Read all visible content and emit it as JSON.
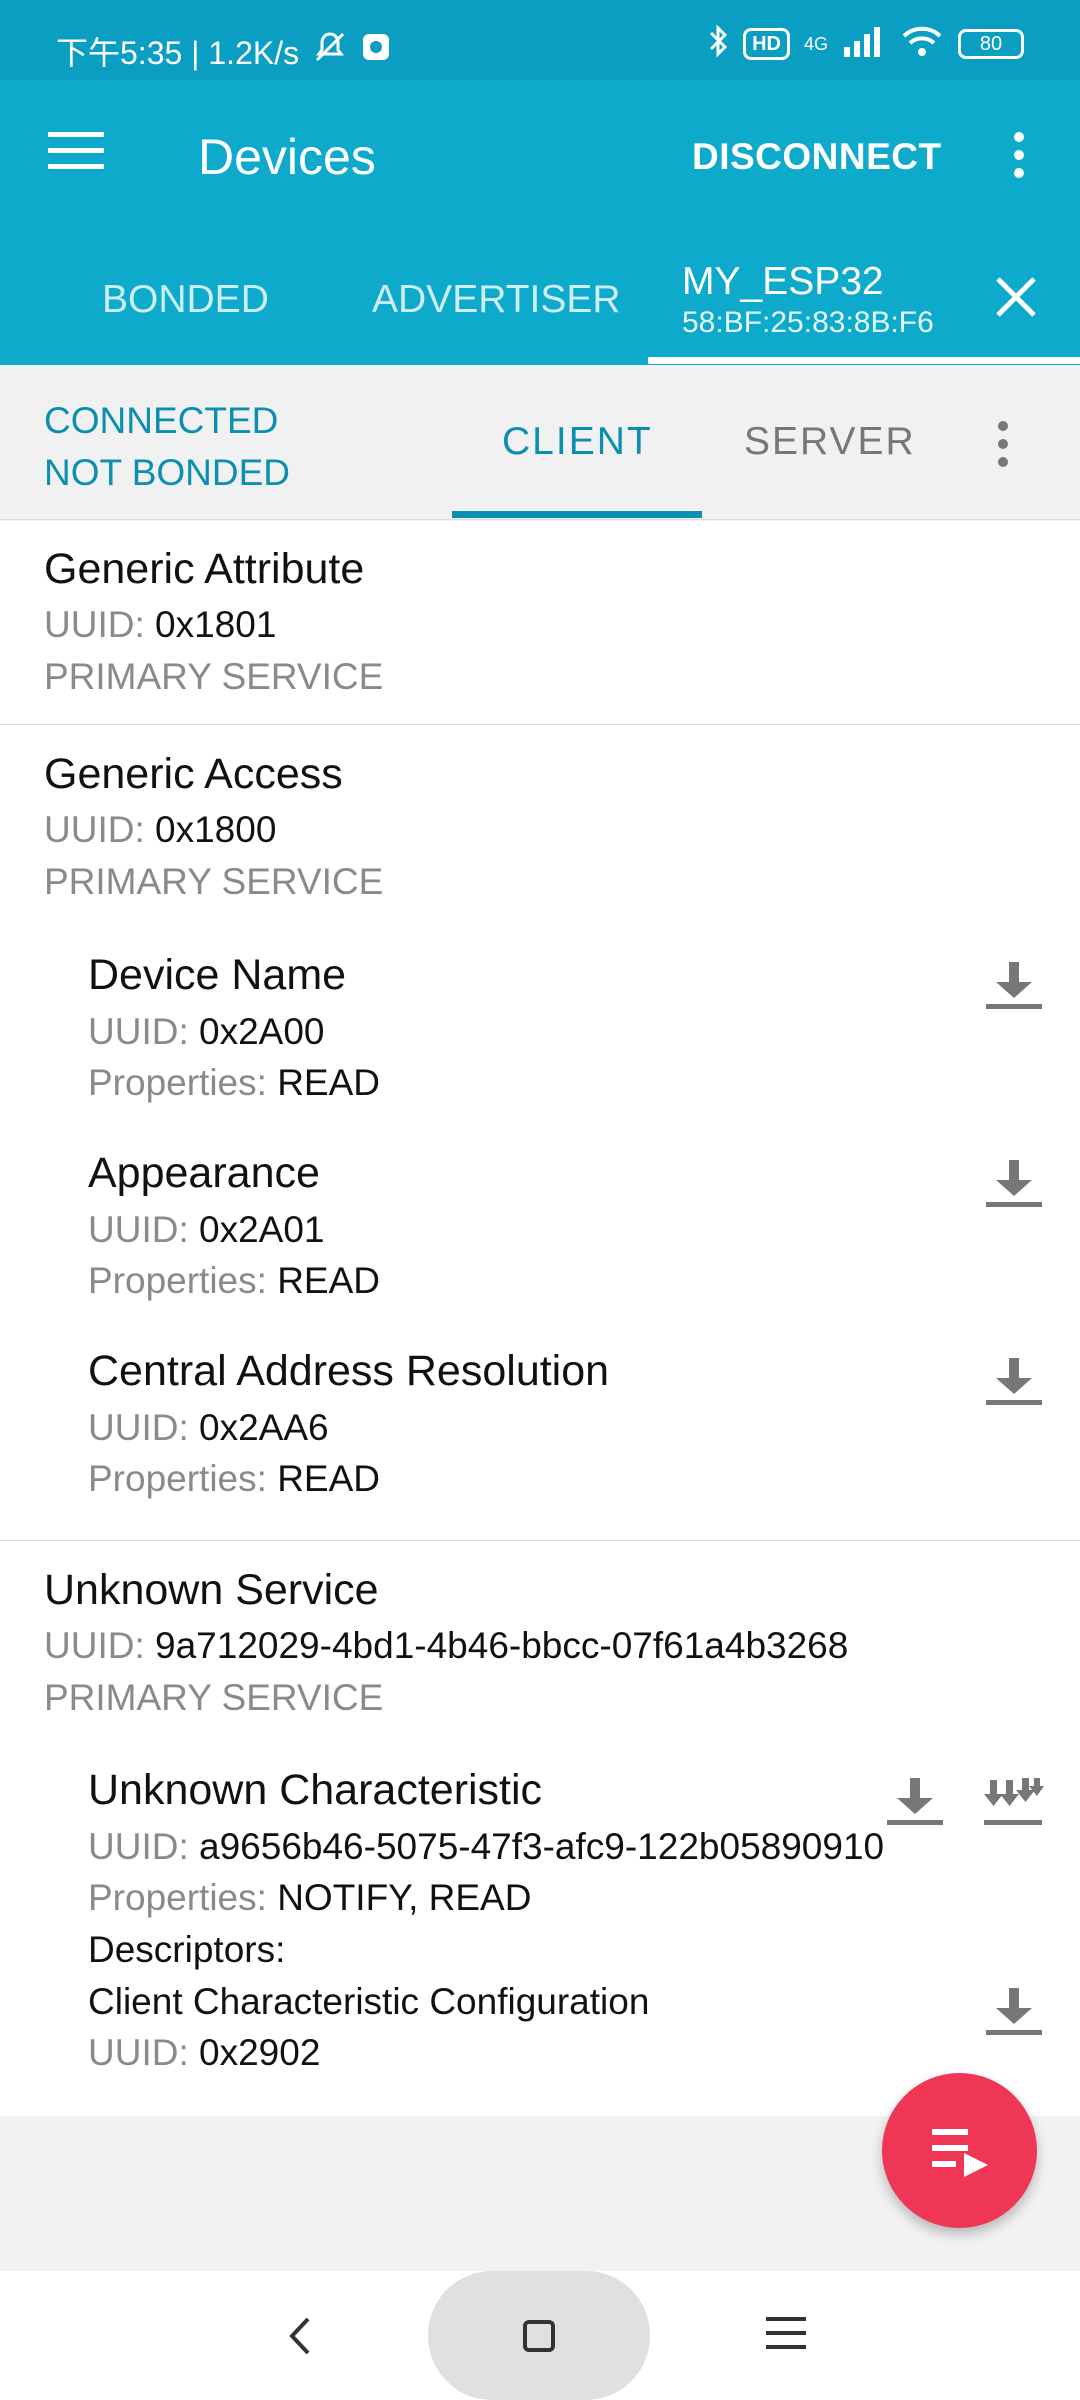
{
  "status_bar": {
    "left_text": "下午5:35 | 1.2K/s",
    "hd_label": "HD",
    "network_label": "4G",
    "battery": "80"
  },
  "app_bar": {
    "title": "Devices",
    "disconnect_label": "DISCONNECT"
  },
  "device_tabs": {
    "bonded_label": "BONDED",
    "advertiser_label": "ADVERTISER",
    "active_device_name": "MY_ESP32",
    "active_device_address": "58:BF:25:83:8B:F6"
  },
  "sub_header": {
    "connection_status": "CONNECTED",
    "bond_status": "NOT BONDED",
    "client_tab": "CLIENT",
    "server_tab": "SERVER"
  },
  "labels": {
    "uuid": "UUID:",
    "properties": "Properties:",
    "descriptors": "Descriptors:"
  },
  "services": [
    {
      "name": "Generic Attribute",
      "uuid": "0x1801",
      "type": "PRIMARY SERVICE",
      "characteristics": []
    },
    {
      "name": "Generic Access",
      "uuid": "0x1800",
      "type": "PRIMARY SERVICE",
      "characteristics": [
        {
          "name": "Device Name",
          "uuid": "0x2A00",
          "properties": "READ"
        },
        {
          "name": "Appearance",
          "uuid": "0x2A01",
          "properties": "READ"
        },
        {
          "name": "Central Address Resolution",
          "uuid": "0x2AA6",
          "properties": "READ"
        }
      ]
    },
    {
      "name": "Unknown Service",
      "uuid": "9a712029-4bd1-4b46-bbcc-07f61a4b3268",
      "type": "PRIMARY SERVICE",
      "characteristics": [
        {
          "name": "Unknown Characteristic",
          "uuid": "a9656b46-5075-47f3-afc9-122b05890910",
          "properties": "NOTIFY, READ",
          "descriptors": [
            {
              "name": "Client Characteristic Configuration",
              "uuid": "0x2902"
            }
          ]
        }
      ]
    }
  ],
  "icons": {
    "menu": "hamburger-icon",
    "overflow": "more-vert-icon",
    "close": "close-icon",
    "read": "download-icon",
    "notify": "notify-arrows-icon",
    "fab": "log-playlist-icon"
  },
  "colors": {
    "primary": "#0eaacb",
    "status_bar": "#0a9ec2",
    "accent_text": "#0a8fb0",
    "fab": "#ef3654"
  }
}
